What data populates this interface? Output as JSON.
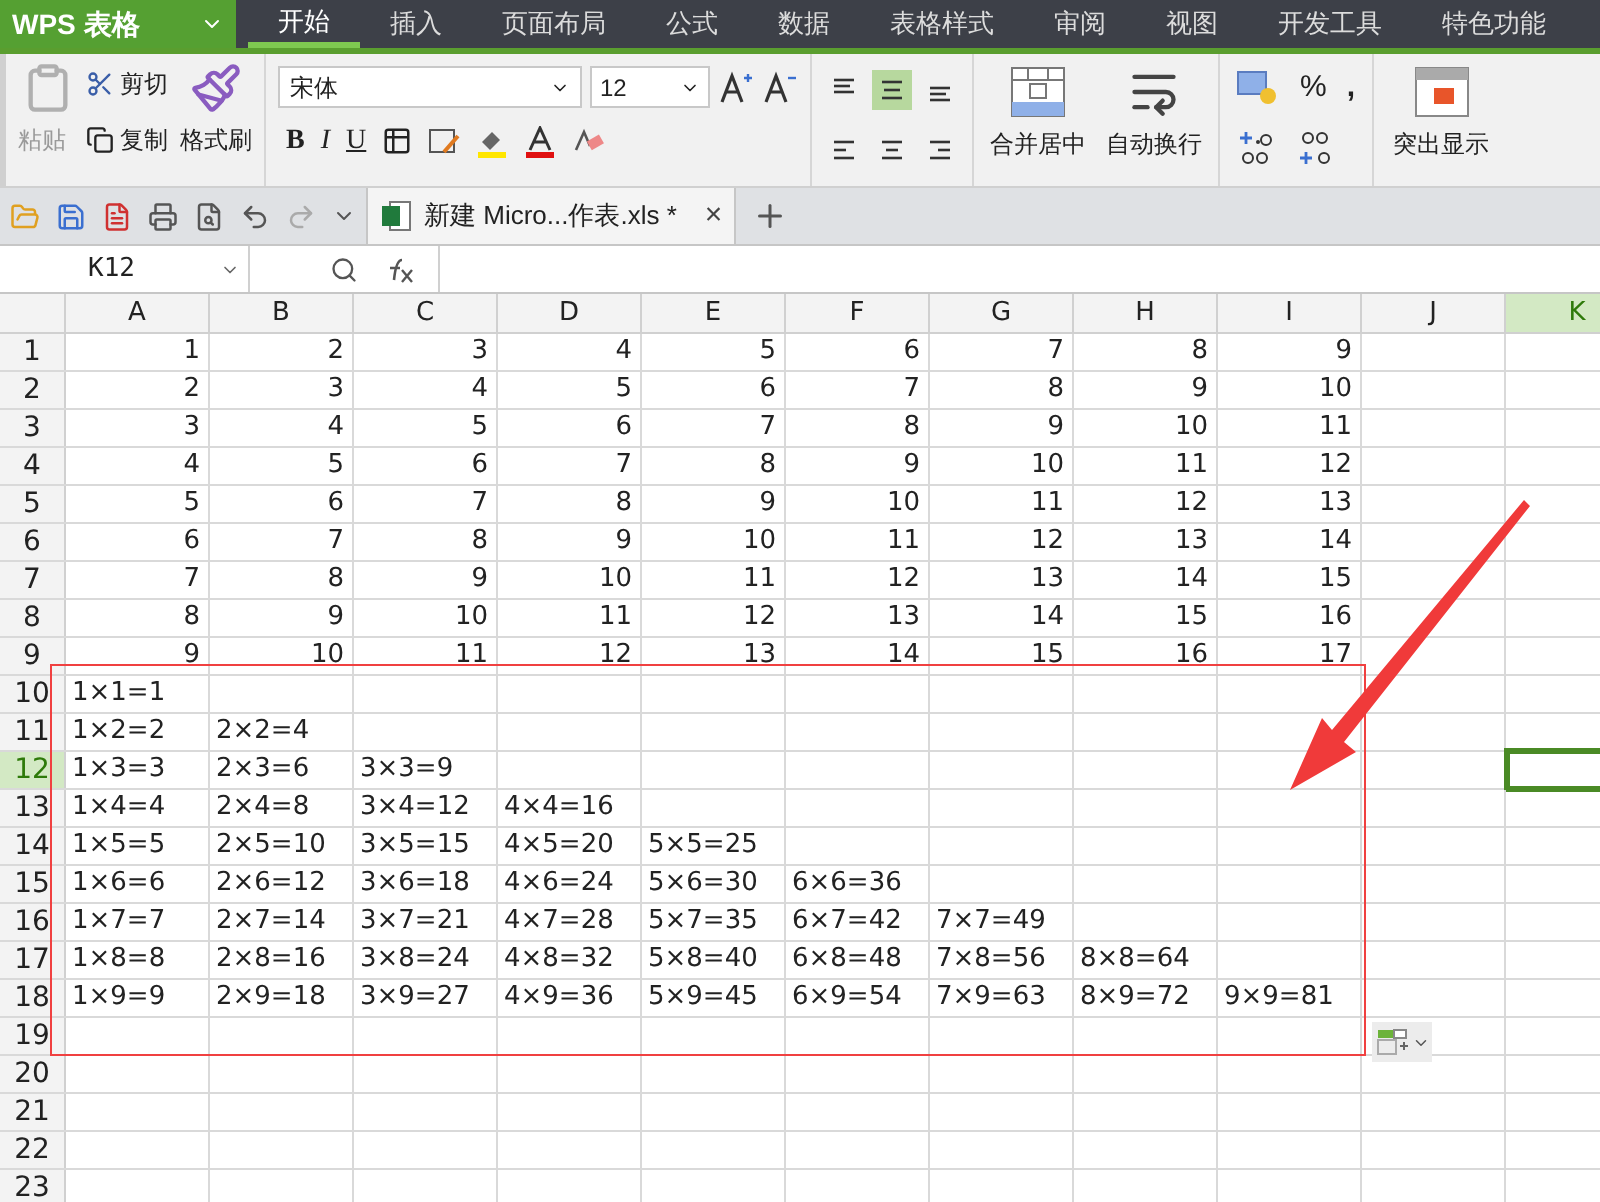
{
  "app_menu": {
    "logo": "WPS 表格"
  },
  "tabs": [
    {
      "label": "开始",
      "selected": true
    },
    {
      "label": "插入",
      "selected": false
    },
    {
      "label": "页面布局",
      "selected": false
    },
    {
      "label": "公式",
      "selected": false
    },
    {
      "label": "数据",
      "selected": false
    },
    {
      "label": "表格样式",
      "selected": false
    },
    {
      "label": "审阅",
      "selected": false
    },
    {
      "label": "视图",
      "selected": false
    },
    {
      "label": "开发工具",
      "selected": false
    },
    {
      "label": "特色功能",
      "selected": false
    }
  ],
  "ribbon": {
    "paste": {
      "label": "粘贴",
      "disabled": true
    },
    "cut": "剪切",
    "copy": "复制",
    "format_painter": "格式刷",
    "font_name": "宋体",
    "font_size": "12",
    "bold": "B",
    "italic": "I",
    "underline": "U",
    "alignment": [
      {
        "kind": "top",
        "selected": false
      },
      {
        "kind": "middle",
        "selected": true
      },
      {
        "kind": "bottom",
        "selected": false
      },
      {
        "kind": "left",
        "selected": false
      },
      {
        "kind": "center",
        "selected": false
      },
      {
        "kind": "right",
        "selected": false
      }
    ],
    "merge": "合并居中",
    "wrap": "自动换行",
    "percent": "%",
    "comma": ",",
    "highlight": "突出显示"
  },
  "document_tab": {
    "title": "新建 Micro...作表.xls *",
    "close": "×"
  },
  "name_box": {
    "value": "K12"
  },
  "sheet": {
    "columns": [
      {
        "label": "A",
        "selected": false
      },
      {
        "label": "B",
        "selected": false
      },
      {
        "label": "C",
        "selected": false
      },
      {
        "label": "D",
        "selected": false
      },
      {
        "label": "E",
        "selected": false
      },
      {
        "label": "F",
        "selected": false
      },
      {
        "label": "G",
        "selected": false
      },
      {
        "label": "H",
        "selected": false
      },
      {
        "label": "I",
        "selected": false
      },
      {
        "label": "J",
        "selected": false
      },
      {
        "label": "K",
        "selected": true
      }
    ],
    "rows": [
      {
        "number": "1",
        "selected": false,
        "kind": "number",
        "cells": [
          "1",
          "2",
          "3",
          "4",
          "5",
          "6",
          "7",
          "8",
          "9"
        ]
      },
      {
        "number": "2",
        "selected": false,
        "kind": "number",
        "cells": [
          "2",
          "3",
          "4",
          "5",
          "6",
          "7",
          "8",
          "9",
          "10"
        ]
      },
      {
        "number": "3",
        "selected": false,
        "kind": "number",
        "cells": [
          "3",
          "4",
          "5",
          "6",
          "7",
          "8",
          "9",
          "10",
          "11"
        ]
      },
      {
        "number": "4",
        "selected": false,
        "kind": "number",
        "cells": [
          "4",
          "5",
          "6",
          "7",
          "8",
          "9",
          "10",
          "11",
          "12"
        ]
      },
      {
        "number": "5",
        "selected": false,
        "kind": "number",
        "cells": [
          "5",
          "6",
          "7",
          "8",
          "9",
          "10",
          "11",
          "12",
          "13"
        ]
      },
      {
        "number": "6",
        "selected": false,
        "kind": "number",
        "cells": [
          "6",
          "7",
          "8",
          "9",
          "10",
          "11",
          "12",
          "13",
          "14"
        ]
      },
      {
        "number": "7",
        "selected": false,
        "kind": "number",
        "cells": [
          "7",
          "8",
          "9",
          "10",
          "11",
          "12",
          "13",
          "14",
          "15"
        ]
      },
      {
        "number": "8",
        "selected": false,
        "kind": "number",
        "cells": [
          "8",
          "9",
          "10",
          "11",
          "12",
          "13",
          "14",
          "15",
          "16"
        ]
      },
      {
        "number": "9",
        "selected": false,
        "kind": "number",
        "cells": [
          "9",
          "10",
          "11",
          "12",
          "13",
          "14",
          "15",
          "16",
          "17"
        ]
      },
      {
        "number": "10",
        "selected": false,
        "kind": "text",
        "cells": [
          "1×1=1"
        ]
      },
      {
        "number": "11",
        "selected": false,
        "kind": "text",
        "cells": [
          "1×2=2",
          "2×2=4"
        ]
      },
      {
        "number": "12",
        "selected": true,
        "kind": "text",
        "cells": [
          "1×3=3",
          "2×3=6",
          "3×3=9"
        ]
      },
      {
        "number": "13",
        "selected": false,
        "kind": "text",
        "cells": [
          "1×4=4",
          "2×4=8",
          "3×4=12",
          "4×4=16"
        ]
      },
      {
        "number": "14",
        "selected": false,
        "kind": "text",
        "cells": [
          "1×5=5",
          "2×5=10",
          "3×5=15",
          "4×5=20",
          "5×5=25"
        ]
      },
      {
        "number": "15",
        "selected": false,
        "kind": "text",
        "cells": [
          "1×6=6",
          "2×6=12",
          "3×6=18",
          "4×6=24",
          "5×6=30",
          "6×6=36"
        ]
      },
      {
        "number": "16",
        "selected": false,
        "kind": "text",
        "cells": [
          "1×7=7",
          "2×7=14",
          "3×7=21",
          "4×7=28",
          "5×7=35",
          "6×7=42",
          "7×7=49"
        ]
      },
      {
        "number": "17",
        "selected": false,
        "kind": "text",
        "cells": [
          "1×8=8",
          "2×8=16",
          "3×8=24",
          "4×8=32",
          "5×8=40",
          "6×8=48",
          "7×8=56",
          "8×8=64"
        ]
      },
      {
        "number": "18",
        "selected": false,
        "kind": "text",
        "cells": [
          "1×9=9",
          "2×9=18",
          "3×9=27",
          "4×9=36",
          "5×9=45",
          "6×9=54",
          "7×9=63",
          "8×9=72",
          "9×9=81"
        ]
      },
      {
        "number": "19",
        "selected": false,
        "kind": "text",
        "cells": []
      },
      {
        "number": "20",
        "selected": false,
        "kind": "text",
        "cells": []
      },
      {
        "number": "21",
        "selected": false,
        "kind": "text",
        "cells": []
      },
      {
        "number": "22",
        "selected": false,
        "kind": "text",
        "cells": []
      },
      {
        "number": "23",
        "selected": false,
        "kind": "text",
        "cells": []
      }
    ]
  }
}
